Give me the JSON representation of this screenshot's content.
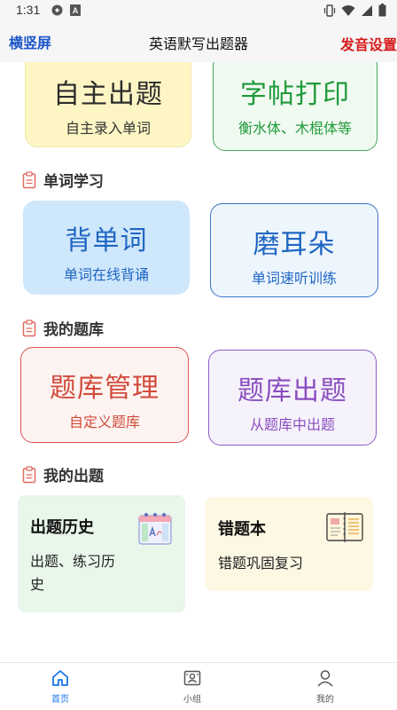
{
  "status_bar": {
    "time": "1:31",
    "icons": [
      "sync-icon",
      "a-badge-icon",
      "vibrate-icon",
      "wifi-icon",
      "signal-icon",
      "battery-icon"
    ]
  },
  "app_bar": {
    "left_action": "横竖屏",
    "title": "英语默写出题器",
    "right_action": "发音设置"
  },
  "cards_top": [
    {
      "title": "自主出题",
      "subtitle": "自主录入单词",
      "bg": "#fdf6c4",
      "border": "#f0e9a7",
      "color": "#2b2b2b"
    },
    {
      "title": "字帖打印",
      "subtitle": "衡水体、木棍体等",
      "bg": "#f1faf1",
      "border": "#49a75c",
      "color": "#1f9a3a"
    }
  ],
  "sections": [
    {
      "label": "单词学习"
    },
    {
      "label": "我的题库"
    },
    {
      "label": "我的出题"
    }
  ],
  "cards_study": [
    {
      "title": "背单词",
      "subtitle": "单词在线背诵",
      "bg": "#cfe7fb",
      "color": "#1f66c2"
    },
    {
      "title": "磨耳朵",
      "subtitle": "单词速听训练",
      "bg": "#eef6fd",
      "border": "#3a74c4",
      "color": "#1f66c2"
    }
  ],
  "cards_bank": [
    {
      "title": "题库管理",
      "subtitle": "自定义题库",
      "bg": "#fdf4f2",
      "border": "#d9534f",
      "color": "#d14a3a"
    },
    {
      "title": "题库出题",
      "subtitle": "从题库中出题",
      "bg": "#f6f2fb",
      "border": "#8e5cc4",
      "color": "#8a4ec0"
    }
  ],
  "cards_mine": [
    {
      "title": "出题历史",
      "description": [
        "出题、练习历",
        "史"
      ],
      "bg": "#e9f6ea"
    },
    {
      "title": "错题本",
      "description": [
        "错题巩固复习"
      ],
      "bg": "#fdf8e4"
    }
  ],
  "tab_bar": {
    "items": [
      {
        "label": "首页",
        "icon": "home-icon",
        "active": true
      },
      {
        "label": "小组",
        "icon": "group-icon",
        "active": false
      },
      {
        "label": "我的",
        "icon": "user-icon",
        "active": false
      }
    ],
    "active_color": "#1a73e8",
    "inactive_color": "#555555"
  }
}
